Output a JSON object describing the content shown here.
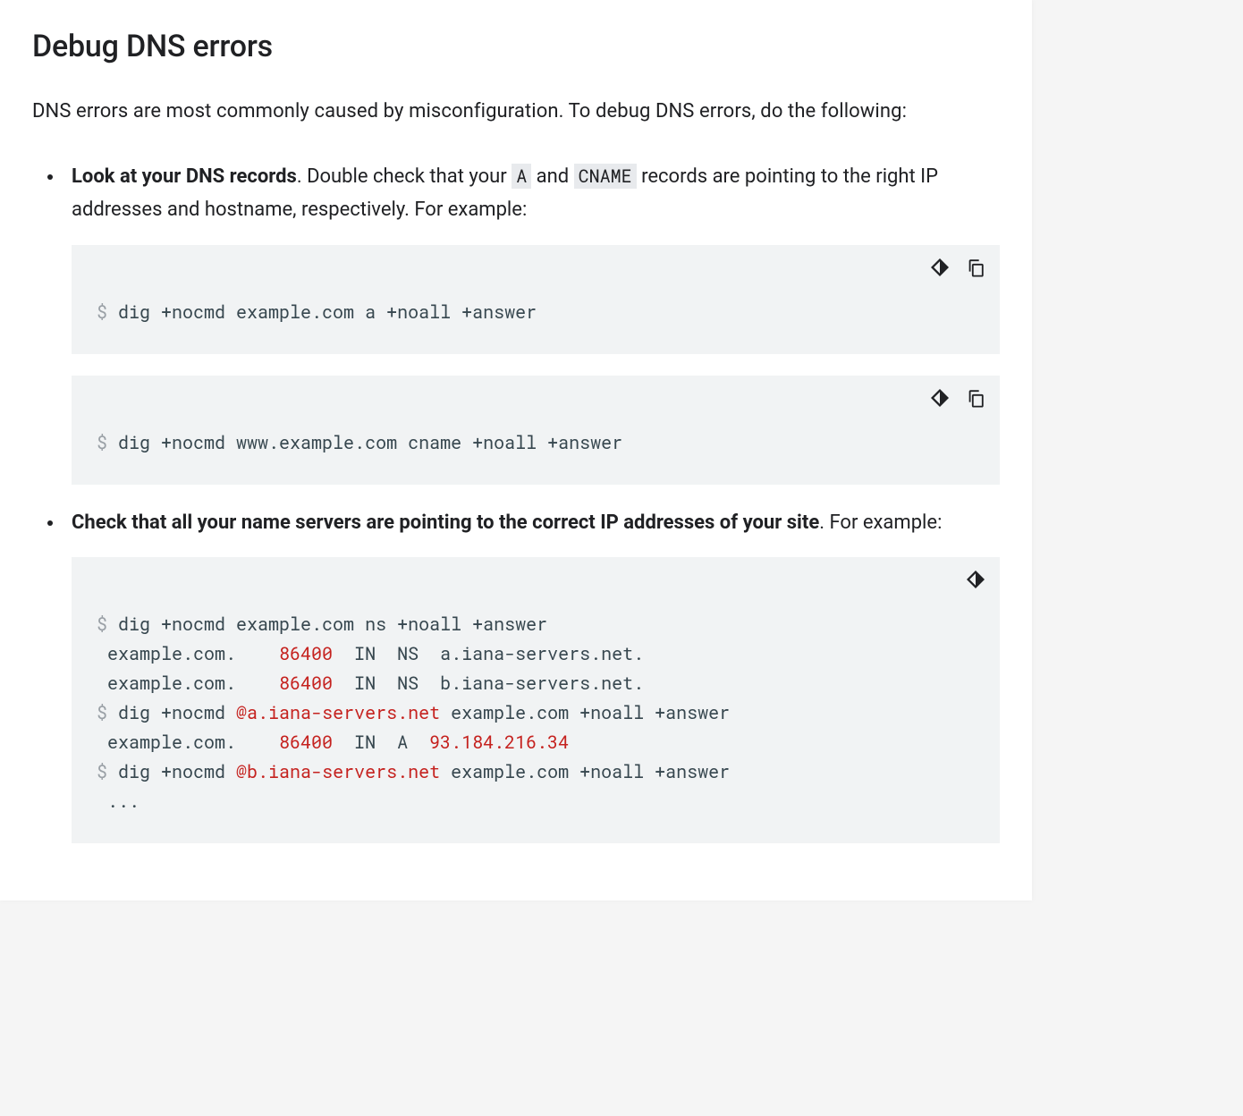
{
  "heading": "Debug DNS errors",
  "intro": "DNS errors are most commonly caused by misconfiguration. To debug DNS errors, do the following:",
  "step1": {
    "bold": "Look at your DNS records",
    "tail1": ". Double check that your ",
    "code_a": "A",
    "tail2": " and ",
    "code_cname": "CNAME",
    "tail3": " records are pointing to the right IP addresses and hostname, respectively. For example:"
  },
  "code1": {
    "prompt": "$",
    "cmd": " dig +nocmd example.com a +noall +answer"
  },
  "code2": {
    "prompt": "$",
    "cmd": " dig +nocmd www.example.com cname +noall +answer"
  },
  "step2": {
    "bold": "Check that all your name servers are pointing to the correct IP addresses of your site",
    "tail": ". For example:"
  },
  "code3": {
    "l1_prompt": "$",
    "l1_cmd": " dig +nocmd example.com ns +noall +answer",
    "l2_a": " example.com.    ",
    "l2_num": "86400",
    "l2_b": "  IN  NS  a.iana-servers.net.",
    "l3_a": " example.com.    ",
    "l3_num": "86400",
    "l3_b": "  IN  NS  b.iana-servers.net.",
    "l4_prompt": "$",
    "l4_a": " dig +nocmd ",
    "l4_host": "@a.iana-servers.net",
    "l4_b": " example.com +noall +answer",
    "l5_a": " example.com.    ",
    "l5_num": "86400",
    "l5_b": "  IN  A  ",
    "l5_ip": "93.184.216.34",
    "l6_prompt": "$",
    "l6_a": " dig +nocmd ",
    "l6_host": "@b.iana-servers.net",
    "l6_b": " example.com +noall +answer",
    "l7": " ..."
  }
}
